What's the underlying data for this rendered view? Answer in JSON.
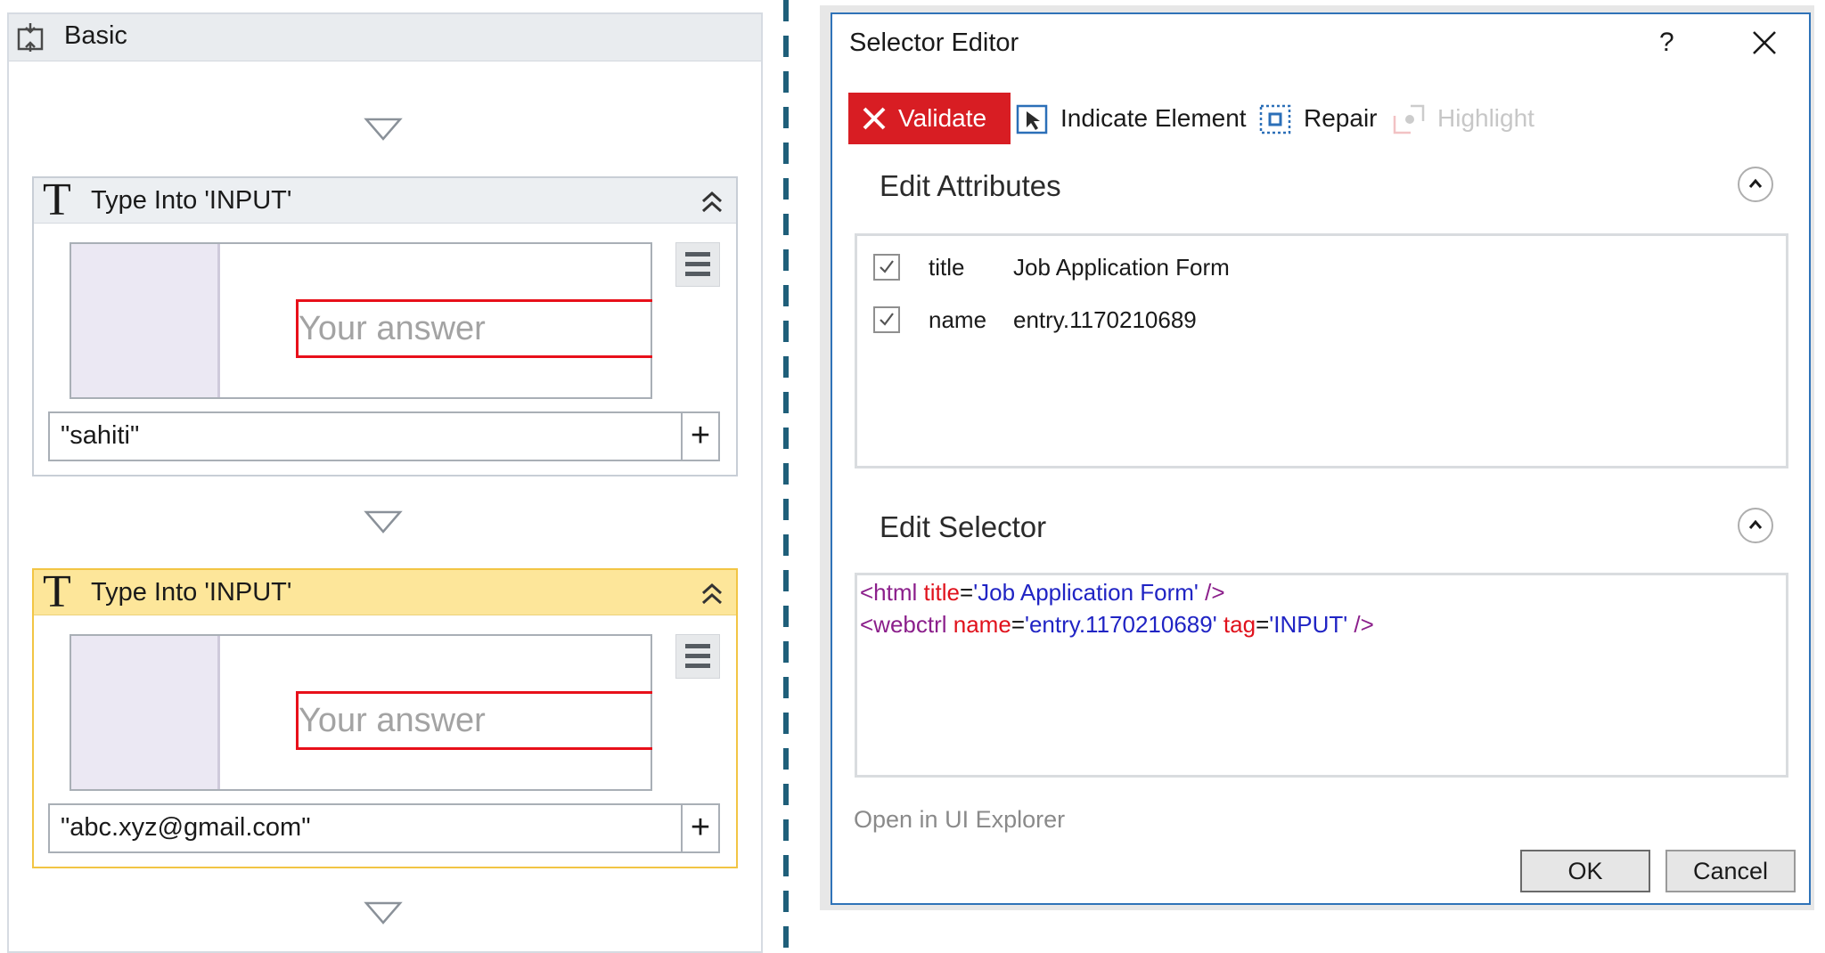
{
  "workflow": {
    "sequence_title": "Basic",
    "activities": [
      {
        "title": "Type Into 'INPUT'",
        "icon_glyph": "T",
        "preview_placeholder": "Your answer",
        "text_value": "\"sahiti\"",
        "plus_label": "+",
        "selected": false
      },
      {
        "title": "Type Into 'INPUT'",
        "icon_glyph": "T",
        "preview_placeholder": "Your answer",
        "text_value": "\"abc.xyz@gmail.com\"",
        "plus_label": "+",
        "selected": true
      }
    ]
  },
  "dialog": {
    "title": "Selector Editor",
    "help_label": "?",
    "toolbar": {
      "validate_label": "Validate",
      "indicate_label": "Indicate Element",
      "repair_label": "Repair",
      "highlight_label": "Highlight"
    },
    "edit_attributes": {
      "title": "Edit Attributes",
      "rows": [
        {
          "checked": true,
          "name": "title",
          "value": "Job Application Form"
        },
        {
          "checked": true,
          "name": "name",
          "value": "entry.1170210689"
        }
      ]
    },
    "edit_selector": {
      "title": "Edit Selector",
      "line1": {
        "open": "<html ",
        "attr": "title",
        "eq": "=",
        "val": "'Job Application Form'",
        "close": " />"
      },
      "line2": {
        "open": "<webctrl ",
        "attr1": "name",
        "eq1": "=",
        "val1": "'entry.1170210689'",
        "attr2": " tag",
        "eq2": "=",
        "val2": "'INPUT'",
        "close": " />"
      }
    },
    "open_in_explorer_label": "Open in UI Explorer",
    "ok_label": "OK",
    "cancel_label": "Cancel"
  },
  "colors": {
    "validate_bg": "#d81d23",
    "selected_activity_header": "#fde69a",
    "preview_field_border": "#e8101a",
    "dialog_border": "#2f73b8",
    "separator": "#1f5f7a"
  }
}
